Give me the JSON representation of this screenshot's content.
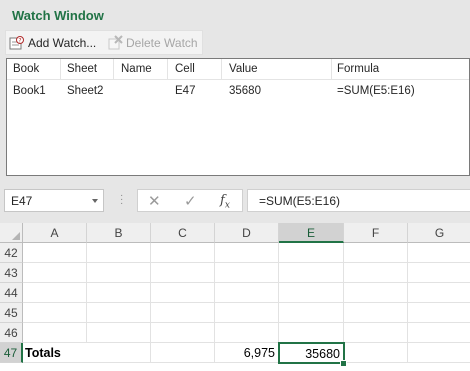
{
  "watch_window": {
    "title": "Watch Window",
    "toolbar": {
      "add_label": "Add Watch...",
      "delete_label": "Delete Watch"
    },
    "columns": [
      "Book",
      "Sheet",
      "Name",
      "Cell",
      "Value",
      "Formula"
    ],
    "rows": [
      [
        "Book1",
        "Sheet2",
        "",
        "E47",
        "35680",
        "=SUM(E5:E16)"
      ]
    ]
  },
  "formula_bar": {
    "name_box": "E47",
    "formula": "=SUM(E5:E16)",
    "icons": [
      "cancel-icon",
      "enter-icon",
      "insert-function-icon"
    ]
  },
  "sheet": {
    "columns": [
      "A",
      "B",
      "C",
      "D",
      "E",
      "F",
      "G"
    ],
    "selected_column": "E",
    "rows": [
      "42",
      "43",
      "44",
      "45",
      "46",
      "47"
    ],
    "selected_row": "47",
    "cells": {
      "A47": "Totals",
      "D47": "6,975",
      "E47": "35680"
    },
    "accent_color": "#217346"
  }
}
